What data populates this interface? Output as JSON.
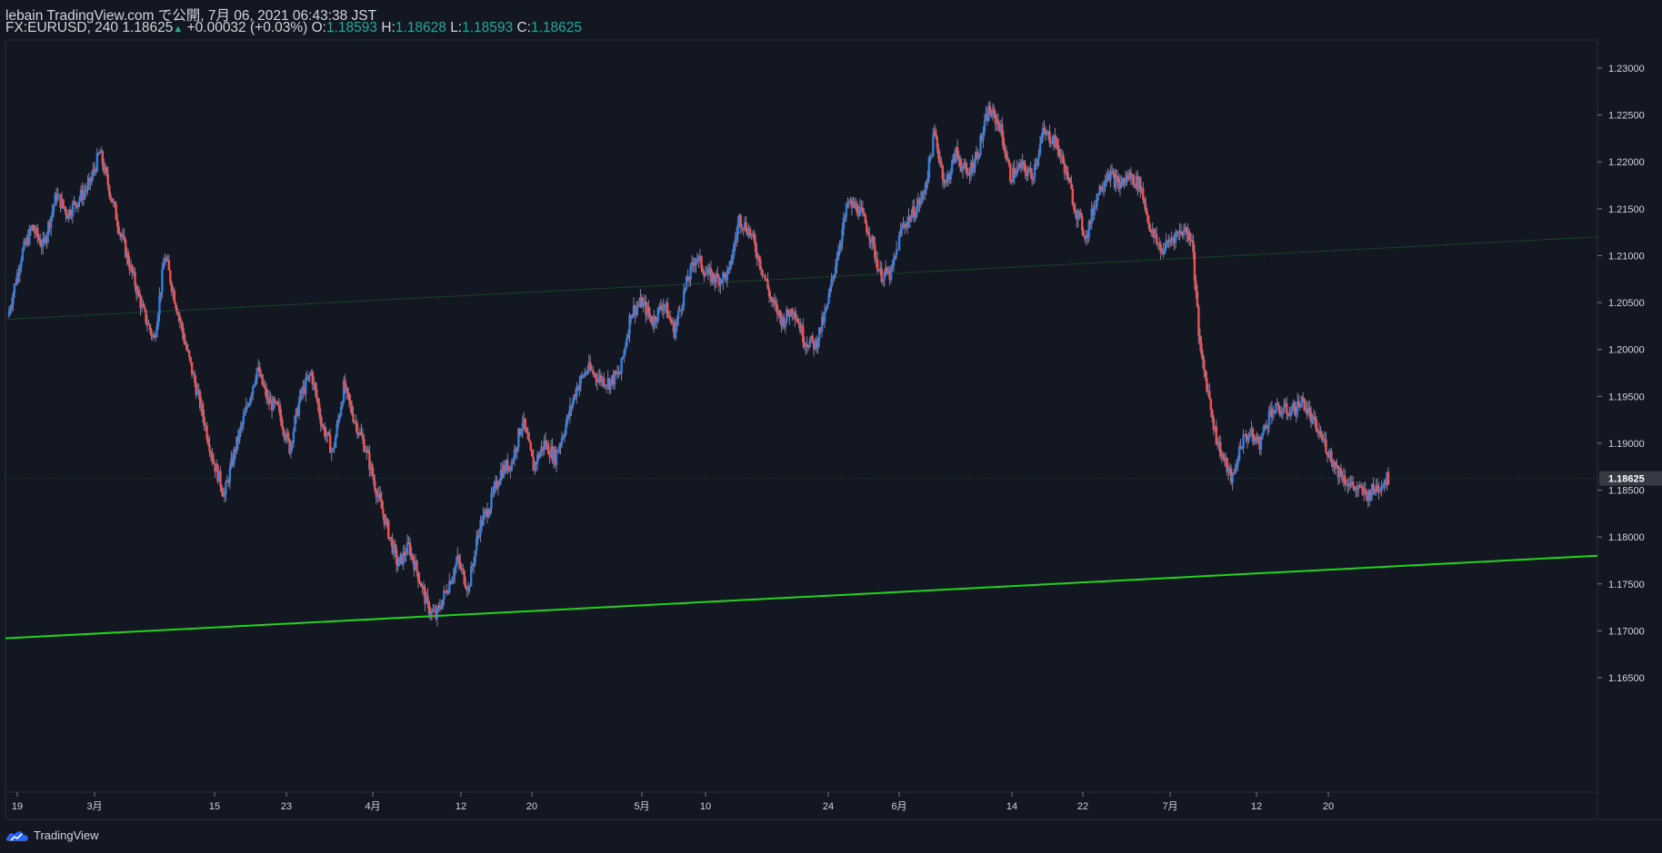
{
  "header": {
    "publish_line": "lebain TradingView.com で公開, 7月 06, 2021 06:43:38 JST",
    "symbol": "FX:EURUSD, 240",
    "last": "1.18625",
    "change_arrow": "▲",
    "change": "+0.00032 (+0.03%)",
    "o_label": "O:",
    "o": "1.18593",
    "h_label": "H:",
    "h": "1.18628",
    "l_label": "L:",
    "l": "1.18593",
    "c_label": "C:",
    "c": "1.18625"
  },
  "footer": {
    "brand": "TradingView",
    "logo_icon": "tradingview-cloud-icon"
  },
  "colors": {
    "background": "#131722",
    "up_candle": "#2f7fe0",
    "down_candle": "#ef5350",
    "trendline": "#22d31b",
    "channel_line": "#1e6b2a",
    "axis_text": "#d1d4dc",
    "last_price_label_bg": "#363a45",
    "ohlc_value": "#26a69a"
  },
  "chart_data": {
    "type": "candlestick",
    "symbol": "FX:EURUSD",
    "interval": "240",
    "ylim": [
      1.165,
      1.2325
    ],
    "y_ticks": [
      "1.23000",
      "1.22500",
      "1.22000",
      "1.21500",
      "1.21000",
      "1.20500",
      "1.20000",
      "1.19500",
      "1.19000",
      "1.18500",
      "1.18000",
      "1.17500",
      "1.17000",
      "1.16500"
    ],
    "x_ticks": [
      "19",
      "3月",
      "15",
      "23",
      "4月",
      "12",
      "20",
      "5月",
      "10",
      "24",
      "6月",
      "14",
      "22",
      "7月",
      "12",
      "20"
    ],
    "last_price": "1.18625",
    "anchors": [
      {
        "t": 0,
        "p": 1.2035
      },
      {
        "t": 5,
        "p": 1.21
      },
      {
        "t": 9,
        "p": 1.213
      },
      {
        "t": 13,
        "p": 1.211
      },
      {
        "t": 18,
        "p": 1.2165
      },
      {
        "t": 22,
        "p": 1.2145
      },
      {
        "t": 26,
        "p": 1.216
      },
      {
        "t": 30,
        "p": 1.2175
      },
      {
        "t": 34,
        "p": 1.221
      },
      {
        "t": 38,
        "p": 1.2165
      },
      {
        "t": 42,
        "p": 1.212
      },
      {
        "t": 46,
        "p": 1.208
      },
      {
        "t": 50,
        "p": 1.204
      },
      {
        "t": 54,
        "p": 1.201
      },
      {
        "t": 58,
        "p": 1.21
      },
      {
        "t": 62,
        "p": 1.205
      },
      {
        "t": 66,
        "p": 1.2
      },
      {
        "t": 72,
        "p": 1.193
      },
      {
        "t": 76,
        "p": 1.188
      },
      {
        "t": 80,
        "p": 1.1845
      },
      {
        "t": 84,
        "p": 1.1895
      },
      {
        "t": 88,
        "p": 1.1935
      },
      {
        "t": 92,
        "p": 1.198
      },
      {
        "t": 96,
        "p": 1.1945
      },
      {
        "t": 100,
        "p": 1.1935
      },
      {
        "t": 104,
        "p": 1.1895
      },
      {
        "t": 108,
        "p": 1.195
      },
      {
        "t": 112,
        "p": 1.1975
      },
      {
        "t": 116,
        "p": 1.192
      },
      {
        "t": 120,
        "p": 1.189
      },
      {
        "t": 124,
        "p": 1.196
      },
      {
        "t": 128,
        "p": 1.1925
      },
      {
        "t": 132,
        "p": 1.1895
      },
      {
        "t": 136,
        "p": 1.185
      },
      {
        "t": 140,
        "p": 1.181
      },
      {
        "t": 144,
        "p": 1.177
      },
      {
        "t": 148,
        "p": 1.179
      },
      {
        "t": 152,
        "p": 1.1755
      },
      {
        "t": 155,
        "p": 1.1725
      },
      {
        "t": 158,
        "p": 1.1715
      },
      {
        "t": 162,
        "p": 1.1745
      },
      {
        "t": 166,
        "p": 1.1775
      },
      {
        "t": 170,
        "p": 1.1745
      },
      {
        "t": 174,
        "p": 1.181
      },
      {
        "t": 178,
        "p": 1.1835
      },
      {
        "t": 182,
        "p": 1.187
      },
      {
        "t": 186,
        "p": 1.188
      },
      {
        "t": 190,
        "p": 1.1925
      },
      {
        "t": 194,
        "p": 1.1875
      },
      {
        "t": 198,
        "p": 1.19
      },
      {
        "t": 202,
        "p": 1.1885
      },
      {
        "t": 206,
        "p": 1.192
      },
      {
        "t": 210,
        "p": 1.196
      },
      {
        "t": 214,
        "p": 1.198
      },
      {
        "t": 218,
        "p": 1.197
      },
      {
        "t": 222,
        "p": 1.1965
      },
      {
        "t": 226,
        "p": 1.1975
      },
      {
        "t": 230,
        "p": 1.204
      },
      {
        "t": 234,
        "p": 1.205
      },
      {
        "t": 238,
        "p": 1.203
      },
      {
        "t": 242,
        "p": 1.205
      },
      {
        "t": 246,
        "p": 1.202
      },
      {
        "t": 250,
        "p": 1.2065
      },
      {
        "t": 254,
        "p": 1.21
      },
      {
        "t": 258,
        "p": 1.208
      },
      {
        "t": 262,
        "p": 1.2075
      },
      {
        "t": 266,
        "p": 1.208
      },
      {
        "t": 270,
        "p": 1.214
      },
      {
        "t": 274,
        "p": 1.2125
      },
      {
        "t": 278,
        "p": 1.209
      },
      {
        "t": 282,
        "p": 1.205
      },
      {
        "t": 286,
        "p": 1.203
      },
      {
        "t": 290,
        "p": 1.2045
      },
      {
        "t": 294,
        "p": 1.201
      },
      {
        "t": 298,
        "p": 1.2005
      },
      {
        "t": 302,
        "p": 1.204
      },
      {
        "t": 306,
        "p": 1.21
      },
      {
        "t": 310,
        "p": 1.2155
      },
      {
        "t": 314,
        "p": 1.215
      },
      {
        "t": 318,
        "p": 1.2125
      },
      {
        "t": 322,
        "p": 1.208
      },
      {
        "t": 326,
        "p": 1.208
      },
      {
        "t": 330,
        "p": 1.213
      },
      {
        "t": 334,
        "p": 1.2145
      },
      {
        "t": 338,
        "p": 1.2165
      },
      {
        "t": 342,
        "p": 1.223
      },
      {
        "t": 346,
        "p": 1.2175
      },
      {
        "t": 350,
        "p": 1.221
      },
      {
        "t": 354,
        "p": 1.2185
      },
      {
        "t": 358,
        "p": 1.221
      },
      {
        "t": 362,
        "p": 1.2255
      },
      {
        "t": 366,
        "p": 1.224
      },
      {
        "t": 370,
        "p": 1.2185
      },
      {
        "t": 374,
        "p": 1.2195
      },
      {
        "t": 378,
        "p": 1.2185
      },
      {
        "t": 382,
        "p": 1.223
      },
      {
        "t": 386,
        "p": 1.2225
      },
      {
        "t": 390,
        "p": 1.2195
      },
      {
        "t": 394,
        "p": 1.215
      },
      {
        "t": 398,
        "p": 1.212
      },
      {
        "t": 402,
        "p": 1.2165
      },
      {
        "t": 406,
        "p": 1.219
      },
      {
        "t": 410,
        "p": 1.2175
      },
      {
        "t": 414,
        "p": 1.2185
      },
      {
        "t": 418,
        "p": 1.2175
      },
      {
        "t": 422,
        "p": 1.2125
      },
      {
        "t": 426,
        "p": 1.2105
      },
      {
        "t": 430,
        "p": 1.212
      },
      {
        "t": 434,
        "p": 1.2128
      },
      {
        "t": 437,
        "p": 1.212
      },
      {
        "t": 440,
        "p": 1.2
      },
      {
        "t": 443,
        "p": 1.1955
      },
      {
        "t": 446,
        "p": 1.1905
      },
      {
        "t": 449,
        "p": 1.188
      },
      {
        "t": 452,
        "p": 1.186
      },
      {
        "t": 455,
        "p": 1.19
      },
      {
        "t": 458,
        "p": 1.191
      },
      {
        "t": 462,
        "p": 1.19
      },
      {
        "t": 466,
        "p": 1.1935
      },
      {
        "t": 470,
        "p": 1.1935
      },
      {
        "t": 474,
        "p": 1.1935
      },
      {
        "t": 478,
        "p": 1.1945
      },
      {
        "t": 482,
        "p": 1.192
      },
      {
        "t": 486,
        "p": 1.19
      },
      {
        "t": 490,
        "p": 1.1875
      },
      {
        "t": 494,
        "p": 1.186
      },
      {
        "t": 498,
        "p": 1.185
      },
      {
        "t": 502,
        "p": 1.1845
      },
      {
        "t": 506,
        "p": 1.1855
      },
      {
        "t": 509,
        "p": 1.1862
      }
    ],
    "trendline": {
      "start": {
        "t": 0,
        "p": 1.1692
      },
      "end": {
        "t": 510,
        "p": 1.178
      }
    },
    "channel_line": {
      "start": {
        "t": 0,
        "p": 1.2032
      },
      "end": {
        "t": 510,
        "p": 1.212
      }
    }
  }
}
